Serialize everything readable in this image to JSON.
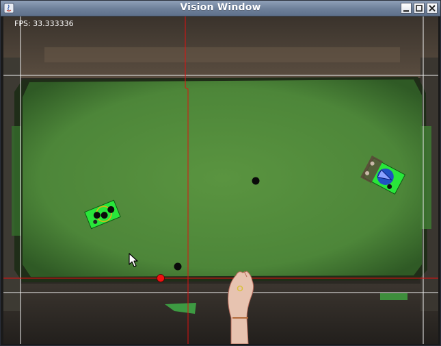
{
  "window": {
    "title": "Vision Window",
    "controls": [
      "minimize",
      "maximize",
      "close"
    ]
  },
  "overlay": {
    "fps_text": "FPS: 33.333336"
  },
  "colors": {
    "field": "#4f8a3c",
    "grid_lines": "#f0f0f0",
    "axis_lines": "#e01010",
    "robot_marker": "#29e63a",
    "ball": "#ee1111"
  },
  "icons": {
    "cursor": "arrow-cursor-icon",
    "app": "java-app-icon"
  }
}
